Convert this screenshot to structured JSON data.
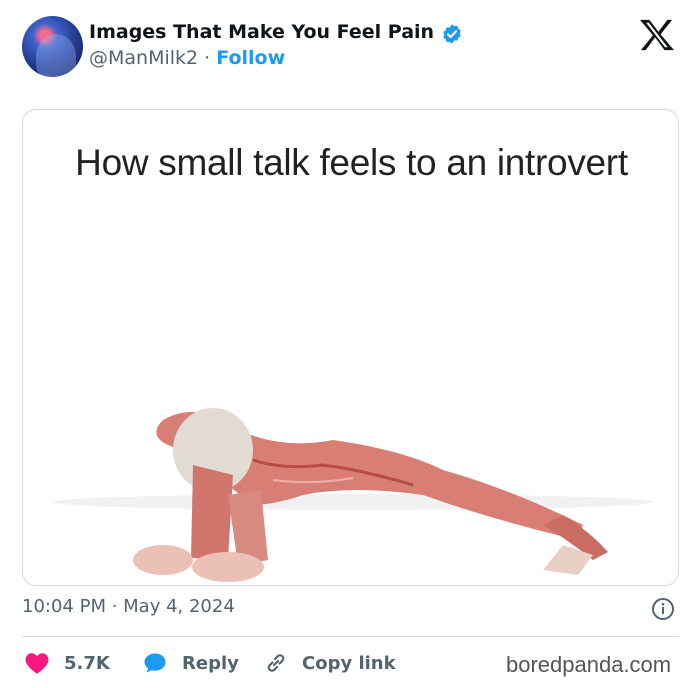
{
  "tweet": {
    "display_name": "Images That Make You Feel Pain",
    "handle": "@ManMilk2",
    "separator": "·",
    "follow_label": "Follow",
    "timestamp": "10:04 PM · May 4, 2024"
  },
  "media": {
    "caption": "How small talk feels to an introvert"
  },
  "actions": {
    "likes": "5.7K",
    "reply_label": "Reply",
    "copy_link_label": "Copy link"
  },
  "watermark": "boredpanda.com",
  "colors": {
    "accent": "#1d9bf0",
    "like": "#f91880",
    "text": "#0f1419",
    "muted": "#536471",
    "border": "#cfd9de"
  },
  "icons": [
    "verified-badge-icon",
    "x-logo-icon",
    "info-icon",
    "heart-icon",
    "reply-icon",
    "link-icon"
  ]
}
